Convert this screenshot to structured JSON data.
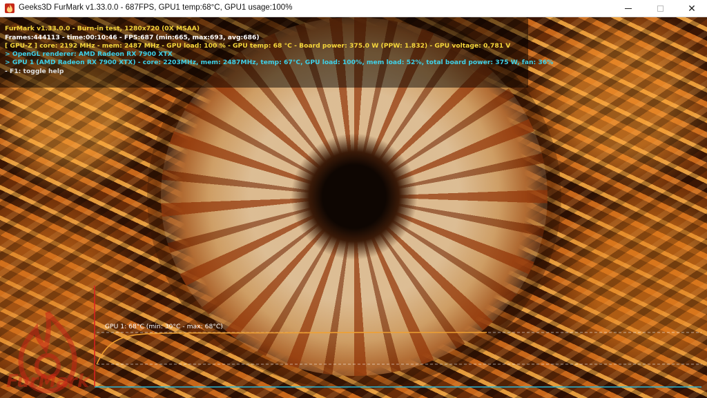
{
  "window": {
    "title": "Geeks3D FurMark v1.33.0.0 - 687FPS, GPU1 temp:68°C, GPU1 usage:100%",
    "icon": "furmark-app-icon",
    "controls": [
      "minimize",
      "maximize",
      "close"
    ],
    "close_glyph": "✕"
  },
  "hud": {
    "line1": "FurMark v1.33.0.0 - Burn-in test, 1280x720 (0X MSAA)",
    "line2": "Frames:444113 - time:00:10:46 - FPS:687 (min:665, max:693, avg:686)",
    "line3": "[ GPU-Z ] core: 2192 MHz - mem: 2487 MHz - GPU load: 100 % - GPU temp: 68 °C - Board power: 375.0 W (PPW: 1.832) - GPU voltage: 0.781 V",
    "line4": "> OpenGL renderer: AMD Radeon RX 7900 XTX",
    "line5": "> GPU 1 (AMD Radeon RX 7900 XTX) - core: 2203MHz, mem: 2487MHz, temp: 67°C, GPU load: 100%, mem load: 52%, total board power: 375 W, fan: 36%",
    "line6": "- F1: toggle help",
    "colors": {
      "line1": "#f5d63b",
      "line2": "#ffffff",
      "line3": "#f5d63b",
      "line4": "#3fd0e8",
      "line5": "#3fd0e8",
      "line6": "#e0e0e0"
    }
  },
  "logo": {
    "text": "FurMark",
    "icon": "furmark-flame-logo"
  },
  "temperature_graph": {
    "label": "GPU 1: 68°C (min: 30°C - max: 68°C)",
    "current": 68,
    "min": 30,
    "max": 68,
    "line_color": "#f0a030",
    "axis_color": "#27b7d8",
    "start_marker_color": "#e02020"
  }
}
